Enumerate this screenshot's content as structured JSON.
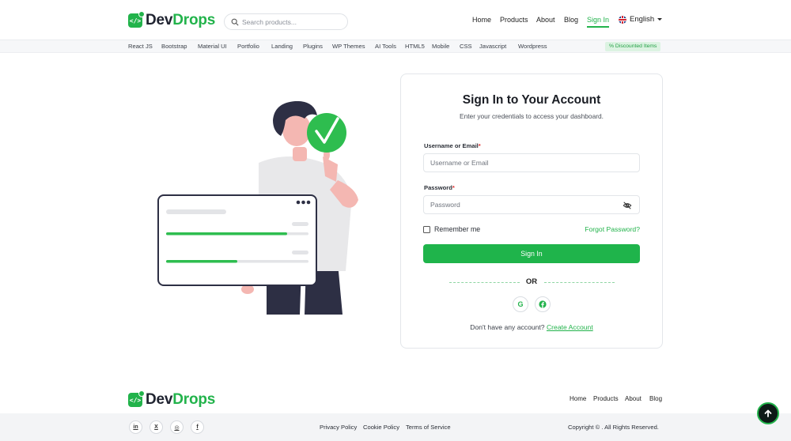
{
  "brand": {
    "name_part1": "Dev",
    "name_part2": "Drops",
    "mark": "</>"
  },
  "search": {
    "placeholder": "Search products..."
  },
  "nav": {
    "home": "Home",
    "products": "Products",
    "about": "About",
    "blog": "Blog",
    "signin": "Sign In"
  },
  "language": {
    "selected": "English"
  },
  "categories": [
    "React JS",
    "Bootstrap",
    "Material UI",
    "Portfolio",
    "Landing",
    "Plugins",
    "WP Themes",
    "AI Tools",
    "HTML5",
    "Mobile",
    "CSS",
    "Javascript",
    "Wordpress"
  ],
  "discount_badge": "% Discounted Items",
  "signin": {
    "title": "Sign In to Your Account",
    "subtitle": "Enter your credentials to access your dashboard.",
    "username_label": "Username or Email",
    "username_placeholder": "Username or Email",
    "password_label": "Password",
    "password_placeholder": "Password",
    "required_mark": "*",
    "remember_label": "Remember me",
    "forgot_link": "Forgot Password?",
    "submit_label": "Sign In",
    "or_text": "OR",
    "google_label": "G",
    "no_account_text": "Don't have any account?",
    "create_account_link": "Create Account"
  },
  "illustration": {
    "progress_1": 0.85,
    "progress_2": 0.5
  },
  "footer": {
    "nav": {
      "home": "Home",
      "products": "Products",
      "about": "About",
      "blog": "Blog"
    },
    "social": {
      "linkedin": "in",
      "x": "X",
      "instagram": "◎",
      "facebook": "f"
    },
    "links": {
      "privacy": "Privacy Policy",
      "cookie": "Cookie Policy",
      "terms": "Terms of Service"
    },
    "copyright": "Copyright © . All Rights Reserved."
  },
  "colors": {
    "accent": "#22b34b",
    "dark": "#1f2330",
    "scroll_top_bg": "#0d1a17"
  },
  "icons": [
    "search-icon",
    "flag-icon",
    "chevron-down-icon",
    "eye-off-icon",
    "google-icon",
    "facebook-icon",
    "linkedin-icon",
    "x-icon",
    "instagram-icon",
    "arrow-up-icon",
    "checkmark-icon"
  ]
}
